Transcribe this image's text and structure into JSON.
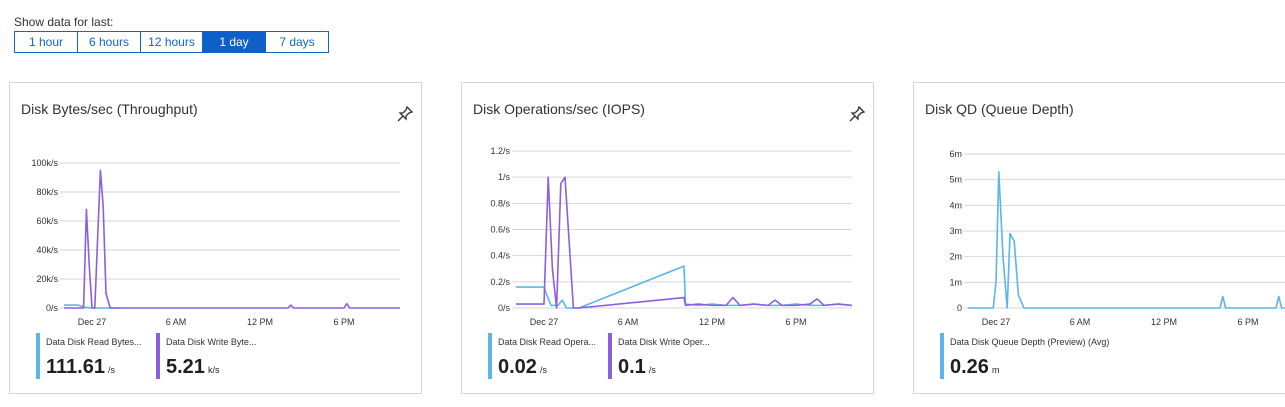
{
  "range": {
    "label": "Show data for last:",
    "options": [
      "1 hour",
      "6 hours",
      "12 hours",
      "1 day",
      "7 days"
    ],
    "selected": "1 day"
  },
  "colors": {
    "accent": "#0f5fc8",
    "read": "#5cb5e6",
    "write": "#8a5fe0"
  },
  "cards": [
    {
      "title": "Disk Bytes/sec (Throughput)",
      "pin_icon": "pin-icon",
      "legend": [
        {
          "name": "Data Disk Read Bytes...",
          "value": "111.61",
          "unit": "/s"
        },
        {
          "name": "Data Disk Write Byte...",
          "value": "5.21",
          "unit": "k/s"
        }
      ]
    },
    {
      "title": "Disk Operations/sec (IOPS)",
      "pin_icon": "pin-icon",
      "legend": [
        {
          "name": "Data Disk Read Opera...",
          "value": "0.02",
          "unit": "/s"
        },
        {
          "name": "Data Disk Write Oper...",
          "value": "0.1",
          "unit": "/s"
        }
      ]
    },
    {
      "title": "Disk QD (Queue Depth)",
      "pin_icon": "pin-icon",
      "legend": [
        {
          "name": "Data Disk Queue Depth (Preview) (Avg)",
          "value": "0.26",
          "unit": "m"
        }
      ]
    }
  ],
  "chart_data": [
    {
      "type": "line",
      "x_ticks": [
        "Dec 27",
        "6 AM",
        "12 PM",
        "6 PM"
      ],
      "y_ticks": [
        "100k/s",
        "80k/s",
        "60k/s",
        "40k/s",
        "20k/s",
        "0/s"
      ],
      "ylim": [
        0,
        100000
      ],
      "series": [
        {
          "name": "Data Disk Read Bytes...",
          "color": "#5cb5e6",
          "x": [
            0,
            1,
            1.5,
            2,
            4
          ],
          "y": [
            2000,
            2000,
            500,
            0,
            0
          ]
        },
        {
          "name": "Data Disk Write Byte...",
          "color": "#8a5fe0",
          "x": [
            0,
            1.4,
            1.6,
            1.8,
            2.0,
            2.2,
            2.6,
            2.8,
            3.0,
            3.3,
            3.6,
            5,
            10,
            16,
            16.2,
            16.4,
            20,
            20.2,
            20.4,
            24
          ],
          "y": [
            0,
            0,
            68000,
            30000,
            0,
            0,
            95000,
            70000,
            10000,
            0,
            0,
            0,
            0,
            0,
            2000,
            0,
            0,
            3000,
            0,
            0
          ]
        }
      ]
    },
    {
      "type": "line",
      "x_ticks": [
        "Dec 27",
        "6 AM",
        "12 PM",
        "6 PM"
      ],
      "y_ticks": [
        "1.2/s",
        "1/s",
        "0.8/s",
        "0.6/s",
        "0.4/s",
        "0.2/s",
        "0/s"
      ],
      "ylim": [
        0,
        1.2
      ],
      "series": [
        {
          "name": "Data Disk Read Opera...",
          "color": "#5cb5e6",
          "x": [
            0,
            2,
            2.2,
            2.5,
            3,
            3.3,
            3.6,
            4,
            4.5,
            12,
            12.1,
            13,
            14,
            15,
            16,
            17,
            18,
            19,
            20,
            21,
            22,
            23,
            24
          ],
          "y": [
            0.16,
            0.16,
            0.1,
            0.02,
            0.02,
            0.06,
            0.0,
            0.0,
            0.0,
            0.32,
            0.03,
            0.02,
            0.03,
            0.02,
            0.02,
            0.03,
            0.02,
            0.02,
            0.03,
            0.02,
            0.02,
            0.03,
            0.02
          ]
        },
        {
          "name": "Data Disk Write Oper...",
          "color": "#8a5fe0",
          "x": [
            0,
            2,
            2.3,
            2.6,
            2.9,
            3.2,
            3.5,
            3.8,
            4.1,
            4.5,
            12,
            12.1,
            13,
            14,
            15,
            15.5,
            16,
            17,
            18,
            18.5,
            19,
            20,
            21,
            21.5,
            22,
            23,
            24
          ],
          "y": [
            0.03,
            0.03,
            1.0,
            0.3,
            0.0,
            0.95,
            1.0,
            0.5,
            0.0,
            0.0,
            0.08,
            0.02,
            0.03,
            0.02,
            0.02,
            0.08,
            0.02,
            0.03,
            0.02,
            0.06,
            0.02,
            0.02,
            0.03,
            0.07,
            0.02,
            0.03,
            0.02
          ]
        }
      ]
    },
    {
      "type": "line",
      "x_ticks": [
        "Dec 27",
        "6 AM",
        "12 PM",
        "6 PM"
      ],
      "y_ticks": [
        "6m",
        "5m",
        "4m",
        "3m",
        "2m",
        "1m",
        "0"
      ],
      "ylim": [
        0,
        6
      ],
      "series": [
        {
          "name": "Data Disk Queue Depth (Preview) (Avg)",
          "color": "#5cb5e6",
          "x": [
            0,
            1.8,
            2.0,
            2.2,
            2.5,
            2.8,
            3.0,
            3.3,
            3.6,
            4.0,
            12,
            18,
            18.2,
            18.4,
            22,
            22.2,
            22.4,
            24
          ],
          "y": [
            0,
            0,
            1,
            5.3,
            2,
            0,
            2.9,
            2.6,
            0.5,
            0,
            0,
            0,
            0.45,
            0,
            0,
            0.45,
            0,
            0
          ]
        }
      ]
    }
  ]
}
